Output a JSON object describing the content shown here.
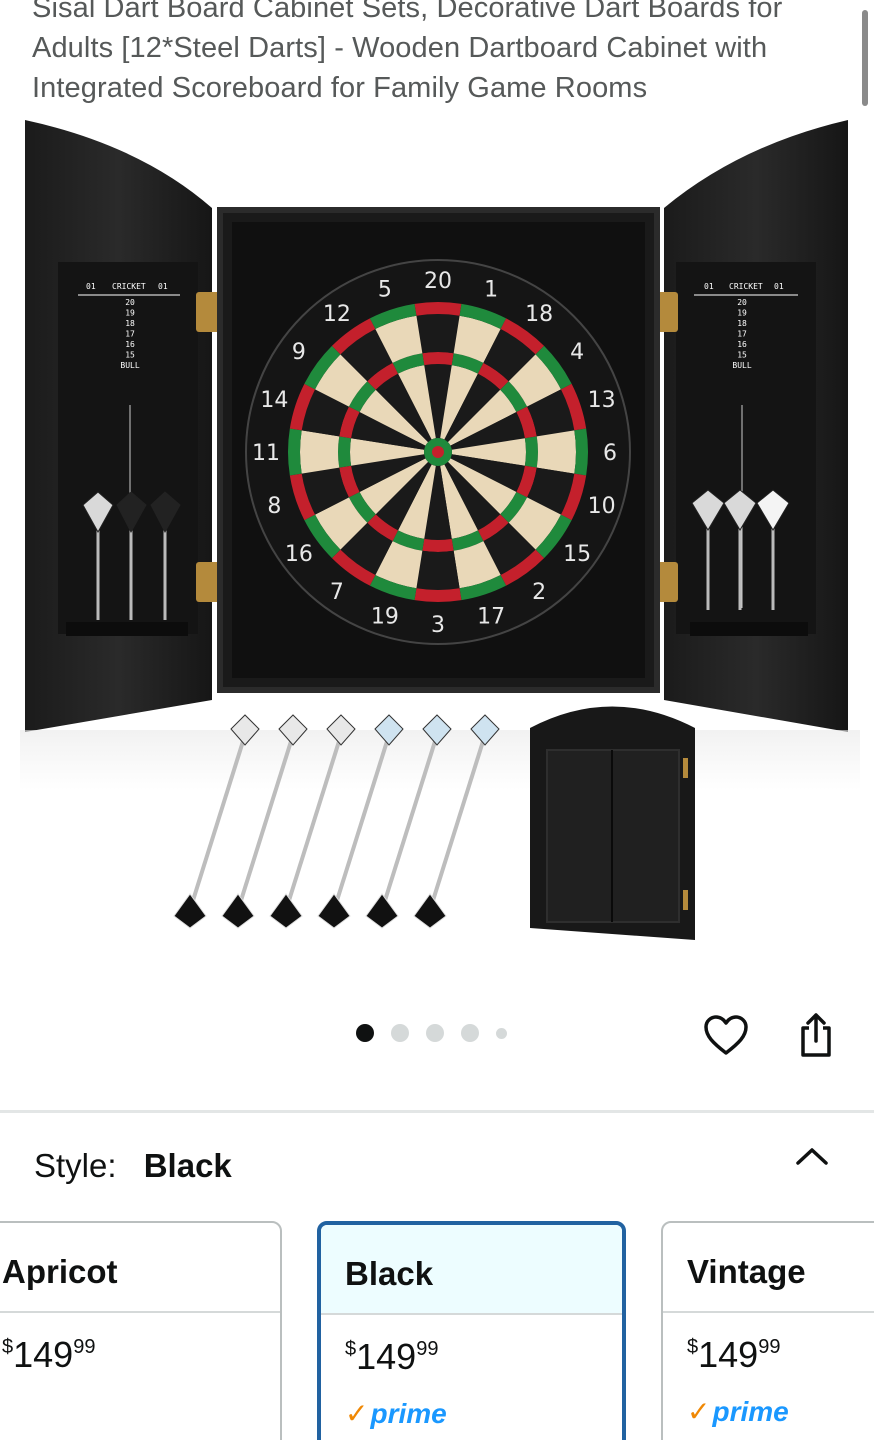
{
  "product": {
    "title": "Sisal Dart Board Cabinet Sets, Decorative Dart Boards for Adults [12*Steel Darts] - Wooden Dartboard Cabinet with Integrated Scoreboard for Family Game Rooms"
  },
  "gallery": {
    "image_count": 5,
    "active_index": 0,
    "board_numbers": [
      "20",
      "1",
      "18",
      "4",
      "13",
      "6",
      "10",
      "15",
      "2",
      "17",
      "3",
      "19",
      "7",
      "16",
      "8",
      "11",
      "14",
      "9",
      "12",
      "5"
    ],
    "scoreboard": {
      "left_label": "01",
      "center_label": "CRICKET",
      "right_label": "01",
      "rows": [
        "20",
        "19",
        "18",
        "17",
        "16",
        "15",
        "BULL"
      ]
    }
  },
  "actions": {
    "favorite_icon": "heart-icon",
    "share_icon": "share-icon"
  },
  "style_selector": {
    "label": "Style:",
    "selected": "Black",
    "collapse_icon": "chevron-up-icon",
    "options": [
      {
        "name": "Apricot",
        "price_dollar": "$",
        "price_whole": "149",
        "price_cents": "99",
        "prime": ""
      },
      {
        "name": "Black",
        "price_dollar": "$",
        "price_whole": "149",
        "price_cents": "99",
        "prime": "prime"
      },
      {
        "name": "Vintage",
        "price_dollar": "$",
        "price_whole": "149",
        "price_cents": "99",
        "prime": "prime"
      }
    ]
  },
  "colors": {
    "selected_border": "#2162a1",
    "prime_blue": "#1a98ff",
    "prime_check": "#f08804"
  }
}
